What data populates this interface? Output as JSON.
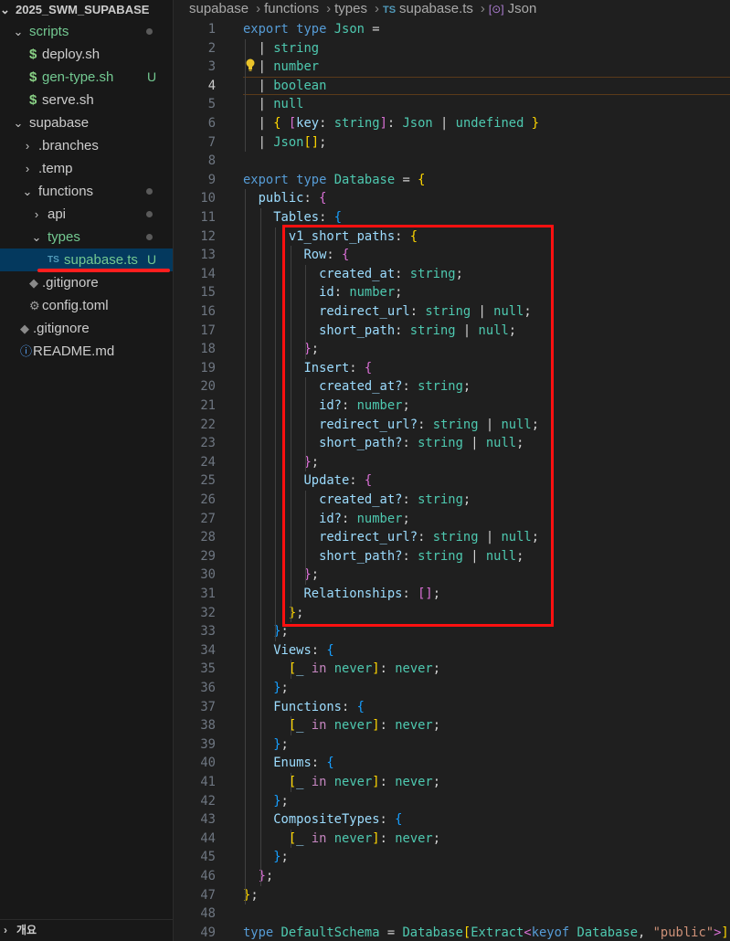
{
  "explorer": {
    "header": "2025_SWM_SUPABASE",
    "footer": "개요",
    "items": [
      {
        "label": "scripts",
        "indent": 1,
        "type": "folder-open",
        "status": "dot",
        "green": true
      },
      {
        "label": "deploy.sh",
        "indent": 2,
        "type": "sh",
        "status": "",
        "green": false
      },
      {
        "label": "gen-type.sh",
        "indent": 2,
        "type": "sh",
        "status": "U",
        "green": true
      },
      {
        "label": "serve.sh",
        "indent": 2,
        "type": "sh",
        "status": "",
        "green": false
      },
      {
        "label": "supabase",
        "indent": 1,
        "type": "folder-open",
        "status": "",
        "green": false
      },
      {
        "label": ".branches",
        "indent": 2,
        "type": "folder-closed",
        "status": "",
        "green": false
      },
      {
        "label": ".temp",
        "indent": 2,
        "type": "folder-closed",
        "status": "",
        "green": false
      },
      {
        "label": "functions",
        "indent": 2,
        "type": "folder-open",
        "status": "dot",
        "green": false
      },
      {
        "label": "api",
        "indent": 3,
        "type": "folder-closed",
        "status": "dot",
        "green": false
      },
      {
        "label": "types",
        "indent": 3,
        "type": "folder-open",
        "status": "dot",
        "green": true
      },
      {
        "label": "supabase.ts",
        "indent": 4,
        "type": "ts",
        "status": "U",
        "green": true,
        "selected": true
      },
      {
        "label": ".gitignore",
        "indent": 2,
        "type": "git",
        "status": "",
        "green": false
      },
      {
        "label": "config.toml",
        "indent": 2,
        "type": "gear",
        "status": "",
        "green": false
      },
      {
        "label": ".gitignore",
        "indent": 1,
        "type": "git",
        "status": "",
        "green": false
      },
      {
        "label": "README.md",
        "indent": 1,
        "type": "info",
        "status": "",
        "green": false
      }
    ]
  },
  "breadcrumb": {
    "parts": [
      "supabase",
      "functions",
      "types"
    ],
    "file_tag": "TS",
    "file": "supabase.ts",
    "symbol_icon": "[⊙]",
    "symbol": "Json"
  },
  "editor": {
    "active_line": 4,
    "lines": [
      {
        "n": "1",
        "t": [
          [
            "export",
            "kw"
          ],
          [
            " ",
            "txt"
          ],
          [
            "type",
            "kw"
          ],
          [
            " ",
            "txt"
          ],
          [
            "Json",
            "ty"
          ],
          [
            " =",
            "txt"
          ]
        ]
      },
      {
        "n": "2",
        "t": [
          [
            "  | ",
            "txt"
          ],
          [
            "string",
            "ty"
          ]
        ]
      },
      {
        "n": "3",
        "t": [
          [
            "  | ",
            "txt"
          ],
          [
            "number",
            "ty"
          ]
        ]
      },
      {
        "n": "4",
        "t": [
          [
            "  | ",
            "txt"
          ],
          [
            "boolean",
            "ty"
          ]
        ]
      },
      {
        "n": "5",
        "t": [
          [
            "  | ",
            "txt"
          ],
          [
            "null",
            "ty"
          ]
        ]
      },
      {
        "n": "6",
        "t": [
          [
            "  | ",
            "txt"
          ],
          [
            "{",
            "b1"
          ],
          [
            " ",
            "txt"
          ],
          [
            "[",
            "b2"
          ],
          [
            "key",
            "prop"
          ],
          [
            ": ",
            "txt"
          ],
          [
            "string",
            "ty"
          ],
          [
            "]",
            "b2"
          ],
          [
            ": ",
            "txt"
          ],
          [
            "Json",
            "ty"
          ],
          [
            " | ",
            "txt"
          ],
          [
            "undefined",
            "ty"
          ],
          [
            " ",
            "txt"
          ],
          [
            "}",
            "b1"
          ]
        ]
      },
      {
        "n": "7",
        "t": [
          [
            "  | ",
            "txt"
          ],
          [
            "Json",
            "ty"
          ],
          [
            "[]",
            "b1"
          ],
          [
            ";",
            "txt"
          ]
        ]
      },
      {
        "n": "8",
        "t": []
      },
      {
        "n": "9",
        "t": [
          [
            "export",
            "kw"
          ],
          [
            " ",
            "txt"
          ],
          [
            "type",
            "kw"
          ],
          [
            " ",
            "txt"
          ],
          [
            "Database",
            "ty"
          ],
          [
            " = ",
            "txt"
          ],
          [
            "{",
            "b1"
          ]
        ]
      },
      {
        "n": "10",
        "t": [
          [
            "  public",
            "prop"
          ],
          [
            ": ",
            "txt"
          ],
          [
            "{",
            "b2"
          ]
        ]
      },
      {
        "n": "11",
        "t": [
          [
            "    Tables",
            "prop"
          ],
          [
            ": ",
            "txt"
          ],
          [
            "{",
            "b3"
          ]
        ]
      },
      {
        "n": "12",
        "t": [
          [
            "      v1_short_paths",
            "prop"
          ],
          [
            ": ",
            "txt"
          ],
          [
            "{",
            "b1"
          ]
        ]
      },
      {
        "n": "13",
        "t": [
          [
            "        Row",
            "prop"
          ],
          [
            ": ",
            "txt"
          ],
          [
            "{",
            "b2"
          ]
        ]
      },
      {
        "n": "14",
        "t": [
          [
            "          created_at",
            "prop"
          ],
          [
            ": ",
            "txt"
          ],
          [
            "string",
            "ty"
          ],
          [
            ";",
            "txt"
          ]
        ]
      },
      {
        "n": "15",
        "t": [
          [
            "          id",
            "prop"
          ],
          [
            ": ",
            "txt"
          ],
          [
            "number",
            "ty"
          ],
          [
            ";",
            "txt"
          ]
        ]
      },
      {
        "n": "16",
        "t": [
          [
            "          redirect_url",
            "prop"
          ],
          [
            ": ",
            "txt"
          ],
          [
            "string",
            "ty"
          ],
          [
            " | ",
            "txt"
          ],
          [
            "null",
            "ty"
          ],
          [
            ";",
            "txt"
          ]
        ]
      },
      {
        "n": "17",
        "t": [
          [
            "          short_path",
            "prop"
          ],
          [
            ": ",
            "txt"
          ],
          [
            "string",
            "ty"
          ],
          [
            " | ",
            "txt"
          ],
          [
            "null",
            "ty"
          ],
          [
            ";",
            "txt"
          ]
        ]
      },
      {
        "n": "18",
        "t": [
          [
            "        }",
            "b2"
          ],
          [
            ";",
            "txt"
          ]
        ]
      },
      {
        "n": "19",
        "t": [
          [
            "        Insert",
            "prop"
          ],
          [
            ": ",
            "txt"
          ],
          [
            "{",
            "b2"
          ]
        ]
      },
      {
        "n": "20",
        "t": [
          [
            "          created_at?",
            "prop"
          ],
          [
            ": ",
            "txt"
          ],
          [
            "string",
            "ty"
          ],
          [
            ";",
            "txt"
          ]
        ]
      },
      {
        "n": "21",
        "t": [
          [
            "          id?",
            "prop"
          ],
          [
            ": ",
            "txt"
          ],
          [
            "number",
            "ty"
          ],
          [
            ";",
            "txt"
          ]
        ]
      },
      {
        "n": "22",
        "t": [
          [
            "          redirect_url?",
            "prop"
          ],
          [
            ": ",
            "txt"
          ],
          [
            "string",
            "ty"
          ],
          [
            " | ",
            "txt"
          ],
          [
            "null",
            "ty"
          ],
          [
            ";",
            "txt"
          ]
        ]
      },
      {
        "n": "23",
        "t": [
          [
            "          short_path?",
            "prop"
          ],
          [
            ": ",
            "txt"
          ],
          [
            "string",
            "ty"
          ],
          [
            " | ",
            "txt"
          ],
          [
            "null",
            "ty"
          ],
          [
            ";",
            "txt"
          ]
        ]
      },
      {
        "n": "24",
        "t": [
          [
            "        }",
            "b2"
          ],
          [
            ";",
            "txt"
          ]
        ]
      },
      {
        "n": "25",
        "t": [
          [
            "        Update",
            "prop"
          ],
          [
            ": ",
            "txt"
          ],
          [
            "{",
            "b2"
          ]
        ]
      },
      {
        "n": "26",
        "t": [
          [
            "          created_at?",
            "prop"
          ],
          [
            ": ",
            "txt"
          ],
          [
            "string",
            "ty"
          ],
          [
            ";",
            "txt"
          ]
        ]
      },
      {
        "n": "27",
        "t": [
          [
            "          id?",
            "prop"
          ],
          [
            ": ",
            "txt"
          ],
          [
            "number",
            "ty"
          ],
          [
            ";",
            "txt"
          ]
        ]
      },
      {
        "n": "28",
        "t": [
          [
            "          redirect_url?",
            "prop"
          ],
          [
            ": ",
            "txt"
          ],
          [
            "string",
            "ty"
          ],
          [
            " | ",
            "txt"
          ],
          [
            "null",
            "ty"
          ],
          [
            ";",
            "txt"
          ]
        ]
      },
      {
        "n": "29",
        "t": [
          [
            "          short_path?",
            "prop"
          ],
          [
            ": ",
            "txt"
          ],
          [
            "string",
            "ty"
          ],
          [
            " | ",
            "txt"
          ],
          [
            "null",
            "ty"
          ],
          [
            ";",
            "txt"
          ]
        ]
      },
      {
        "n": "30",
        "t": [
          [
            "        }",
            "b2"
          ],
          [
            ";",
            "txt"
          ]
        ]
      },
      {
        "n": "31",
        "t": [
          [
            "        Relationships",
            "prop"
          ],
          [
            ": ",
            "txt"
          ],
          [
            "[]",
            "b2"
          ],
          [
            ";",
            "txt"
          ]
        ]
      },
      {
        "n": "32",
        "t": [
          [
            "      }",
            "b1"
          ],
          [
            ";",
            "txt"
          ]
        ]
      },
      {
        "n": "33",
        "t": [
          [
            "    }",
            "b3"
          ],
          [
            ";",
            "txt"
          ]
        ]
      },
      {
        "n": "34",
        "t": [
          [
            "    Views",
            "prop"
          ],
          [
            ": ",
            "txt"
          ],
          [
            "{",
            "b3"
          ]
        ]
      },
      {
        "n": "35",
        "t": [
          [
            "      [",
            "b1"
          ],
          [
            "_ ",
            "prop"
          ],
          [
            "in",
            "ctl"
          ],
          [
            " ",
            "txt"
          ],
          [
            "never",
            "ty"
          ],
          [
            "]",
            "b1"
          ],
          [
            ": ",
            "txt"
          ],
          [
            "never",
            "ty"
          ],
          [
            ";",
            "txt"
          ]
        ]
      },
      {
        "n": "36",
        "t": [
          [
            "    }",
            "b3"
          ],
          [
            ";",
            "txt"
          ]
        ]
      },
      {
        "n": "37",
        "t": [
          [
            "    Functions",
            "prop"
          ],
          [
            ": ",
            "txt"
          ],
          [
            "{",
            "b3"
          ]
        ]
      },
      {
        "n": "38",
        "t": [
          [
            "      [",
            "b1"
          ],
          [
            "_ ",
            "prop"
          ],
          [
            "in",
            "ctl"
          ],
          [
            " ",
            "txt"
          ],
          [
            "never",
            "ty"
          ],
          [
            "]",
            "b1"
          ],
          [
            ": ",
            "txt"
          ],
          [
            "never",
            "ty"
          ],
          [
            ";",
            "txt"
          ]
        ]
      },
      {
        "n": "39",
        "t": [
          [
            "    }",
            "b3"
          ],
          [
            ";",
            "txt"
          ]
        ]
      },
      {
        "n": "40",
        "t": [
          [
            "    Enums",
            "prop"
          ],
          [
            ": ",
            "txt"
          ],
          [
            "{",
            "b3"
          ]
        ]
      },
      {
        "n": "41",
        "t": [
          [
            "      [",
            "b1"
          ],
          [
            "_ ",
            "prop"
          ],
          [
            "in",
            "ctl"
          ],
          [
            " ",
            "txt"
          ],
          [
            "never",
            "ty"
          ],
          [
            "]",
            "b1"
          ],
          [
            ": ",
            "txt"
          ],
          [
            "never",
            "ty"
          ],
          [
            ";",
            "txt"
          ]
        ]
      },
      {
        "n": "42",
        "t": [
          [
            "    }",
            "b3"
          ],
          [
            ";",
            "txt"
          ]
        ]
      },
      {
        "n": "43",
        "t": [
          [
            "    CompositeTypes",
            "prop"
          ],
          [
            ": ",
            "txt"
          ],
          [
            "{",
            "b3"
          ]
        ]
      },
      {
        "n": "44",
        "t": [
          [
            "      [",
            "b1"
          ],
          [
            "_ ",
            "prop"
          ],
          [
            "in",
            "ctl"
          ],
          [
            " ",
            "txt"
          ],
          [
            "never",
            "ty"
          ],
          [
            "]",
            "b1"
          ],
          [
            ": ",
            "txt"
          ],
          [
            "never",
            "ty"
          ],
          [
            ";",
            "txt"
          ]
        ]
      },
      {
        "n": "45",
        "t": [
          [
            "    }",
            "b3"
          ],
          [
            ";",
            "txt"
          ]
        ]
      },
      {
        "n": "46",
        "t": [
          [
            "  }",
            "b2"
          ],
          [
            ";",
            "txt"
          ]
        ]
      },
      {
        "n": "47",
        "t": [
          [
            "}",
            "b1"
          ],
          [
            ";",
            "txt"
          ]
        ]
      },
      {
        "n": "48",
        "t": []
      },
      {
        "n": "49",
        "t": [
          [
            "type",
            "kw"
          ],
          [
            " ",
            "txt"
          ],
          [
            "DefaultSchema",
            "ty"
          ],
          [
            " = ",
            "txt"
          ],
          [
            "Database",
            "ty"
          ],
          [
            "[",
            "b1"
          ],
          [
            "Extract",
            "ty"
          ],
          [
            "<",
            "b2"
          ],
          [
            "keyof",
            "kw"
          ],
          [
            " ",
            "txt"
          ],
          [
            "Database",
            "ty"
          ],
          [
            ", ",
            "txt"
          ],
          [
            "\"public\"",
            "str"
          ],
          [
            ">",
            "b2"
          ],
          [
            "]",
            "b1"
          ],
          [
            ";",
            "txt"
          ]
        ]
      }
    ]
  }
}
